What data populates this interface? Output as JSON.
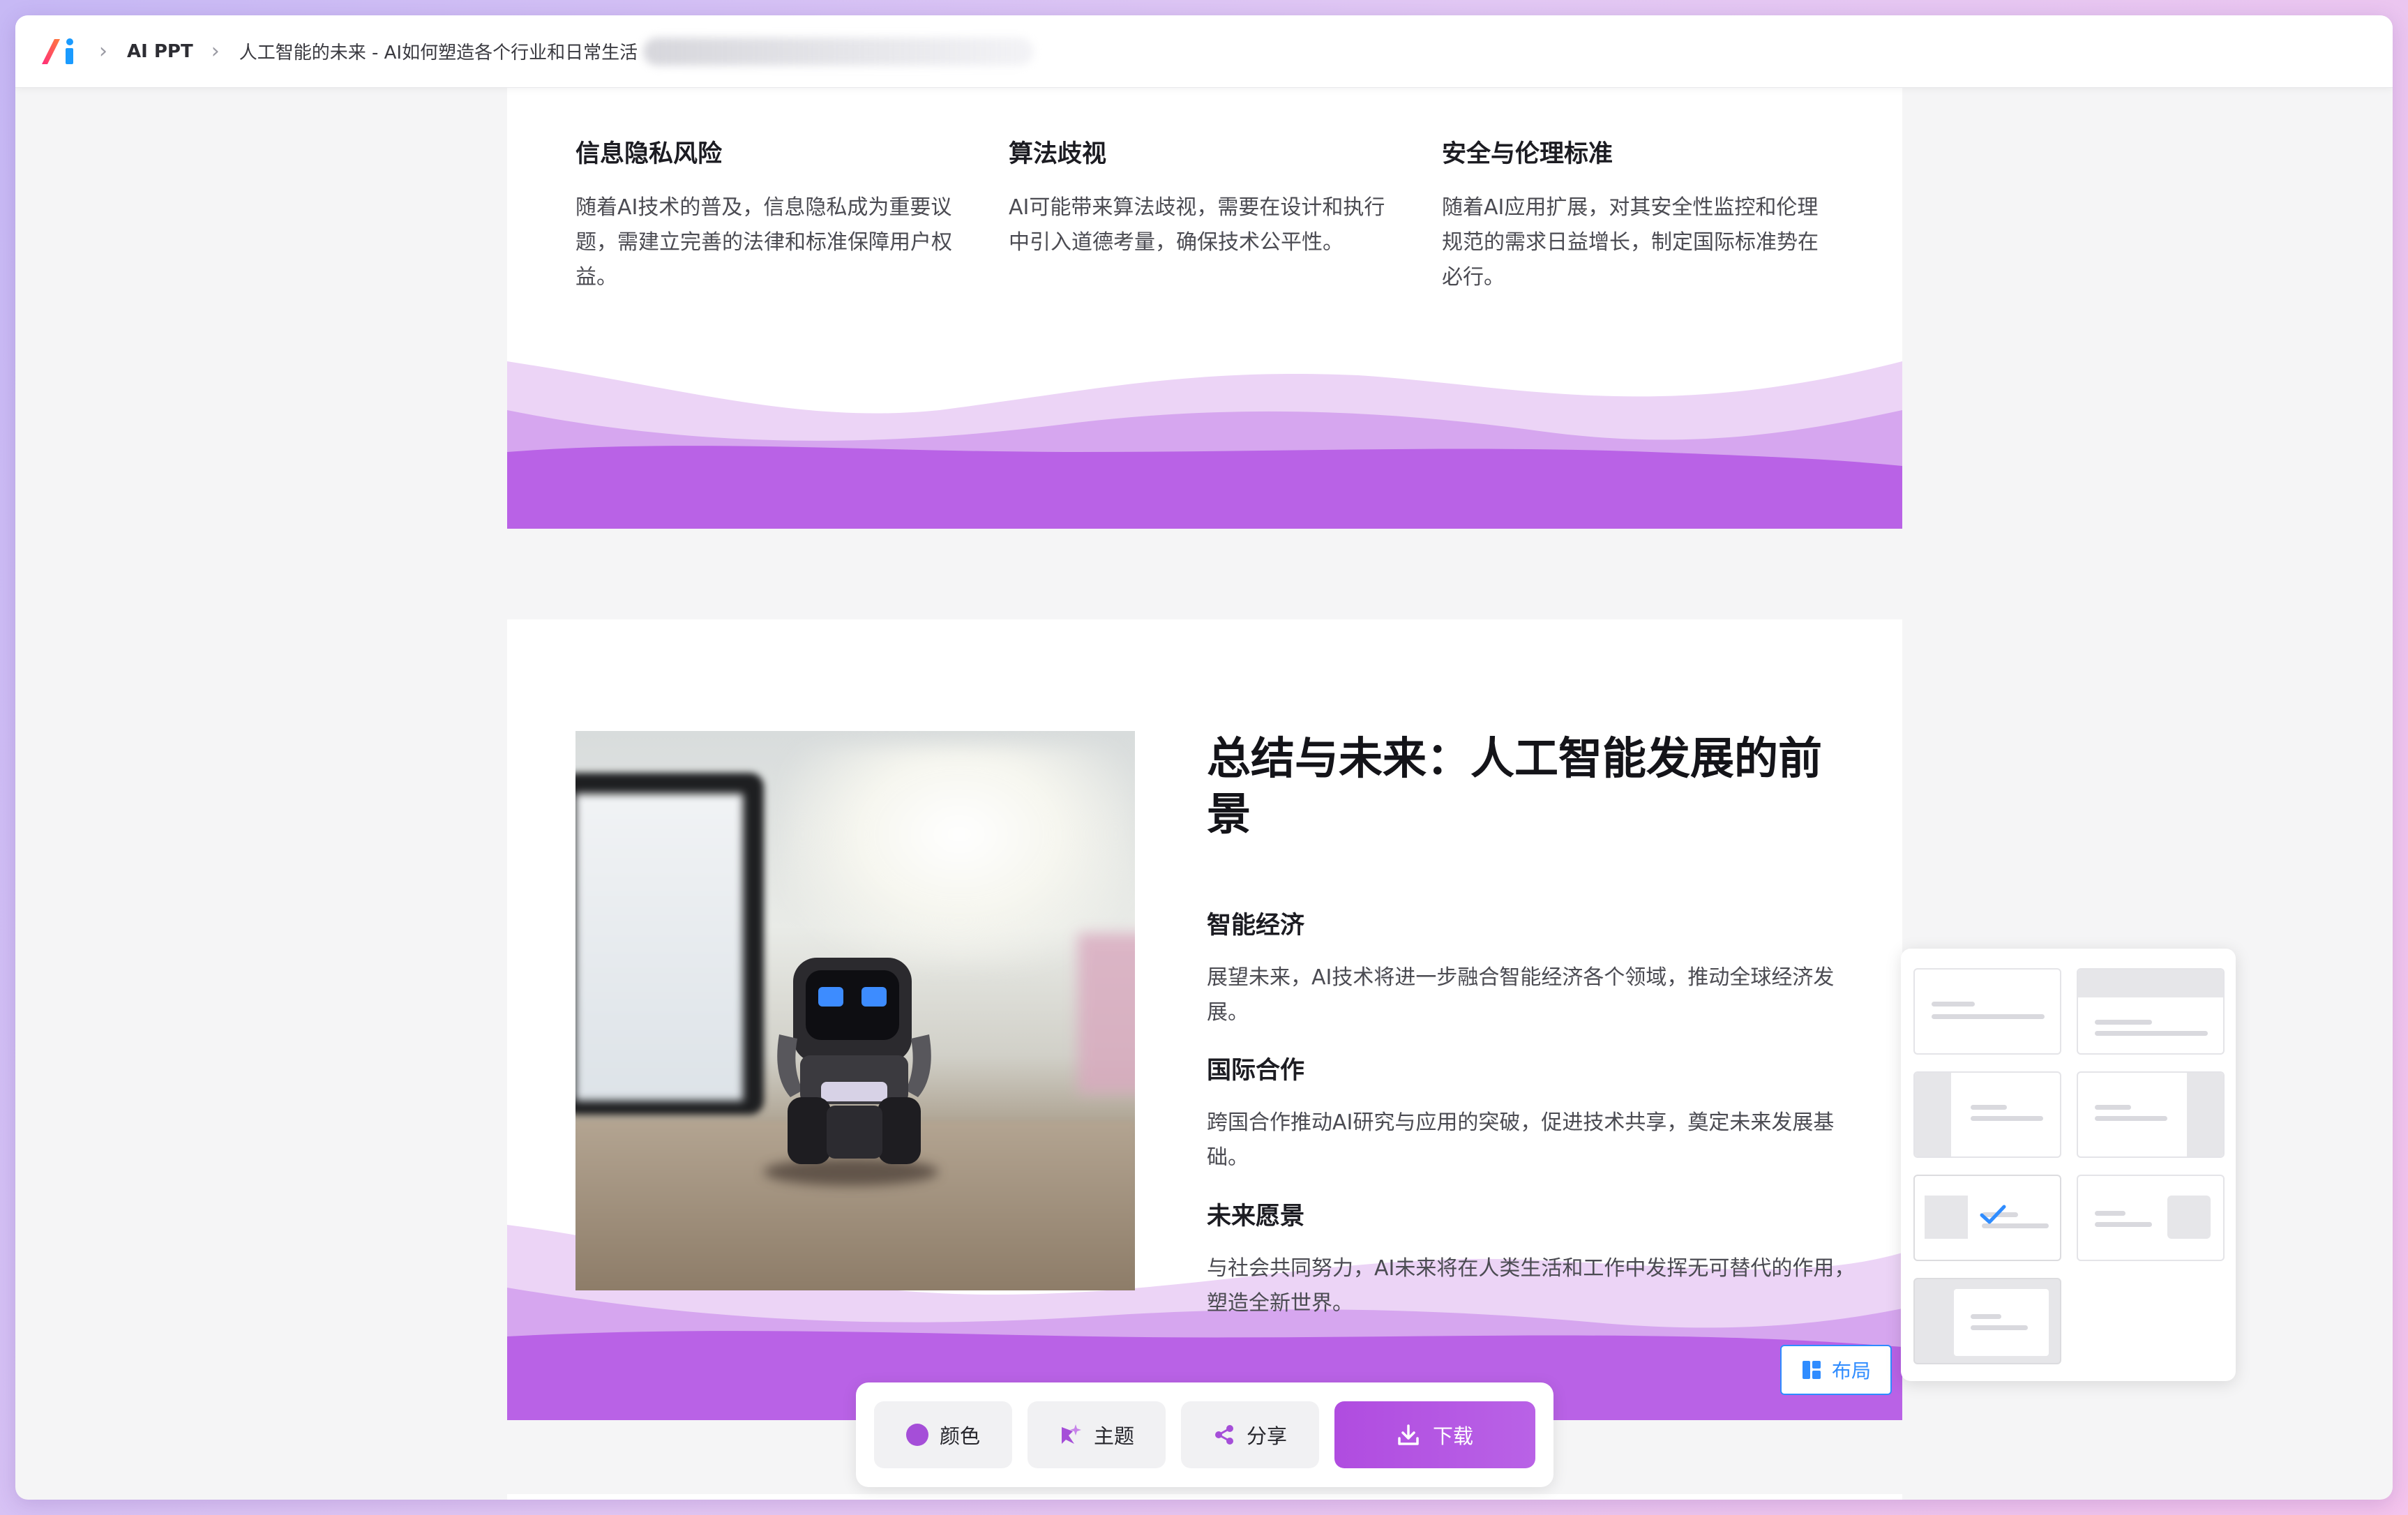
{
  "header": {
    "breadcrumbs": [
      {
        "label": "AI PPT"
      },
      {
        "label": "人工智能的未来 - AI如何塑造各个行业和日常生活"
      }
    ]
  },
  "slide1": {
    "columns": [
      {
        "title": "信息隐私风险",
        "body": "随着AI技术的普及，信息隐私成为重要议题，需建立完善的法律和标准保障用户权益。"
      },
      {
        "title": "算法歧视",
        "body": "AI可能带来算法歧视，需要在设计和执行中引入道德考量，确保技术公平性。"
      },
      {
        "title": "安全与伦理标准",
        "body": "随着AI应用扩展，对其安全性监控和伦理规范的需求日益增长，制定国际标准势在必行。"
      }
    ]
  },
  "slide2": {
    "heading": "总结与未来：人工智能发展的前景",
    "points": [
      {
        "title": "智能经济",
        "body": "展望未来，AI技术将进一步融合智能经济各个领域，推动全球经济发展。"
      },
      {
        "title": "国际合作",
        "body": "跨国合作推动AI研究与应用的突破，促进技术共享，奠定未来发展基础。"
      },
      {
        "title": "未来愿景",
        "body": "与社会共同努力，AI未来将在人类生活和工作中发挥无可替代的作用，塑造全新世界。"
      }
    ],
    "layout_button": "布局"
  },
  "layout_panel": {
    "options": [
      "title-text",
      "header-band",
      "left-sidebar",
      "right-sidebar",
      "image-left",
      "image-right",
      "centered-card"
    ],
    "selected": "image-left"
  },
  "toolbar": {
    "color_label": "颜色",
    "theme_label": "主题",
    "share_label": "分享",
    "download_label": "下载"
  },
  "colors": {
    "accent": "#b04ce0",
    "wave_light": "#e6c8f3",
    "wave_dark": "#b761e4",
    "link_blue": "#2f8cff"
  }
}
